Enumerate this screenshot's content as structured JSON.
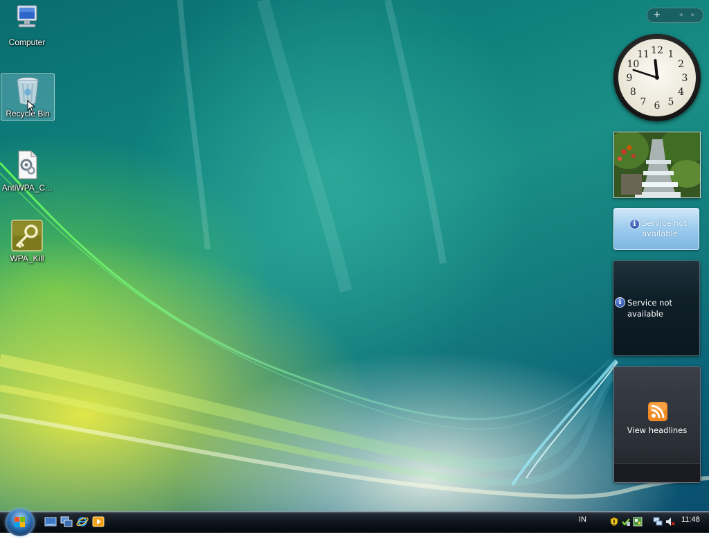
{
  "desktop": {
    "icons": [
      {
        "label": "Computer",
        "icon": "computer-icon"
      },
      {
        "label": "Recycle Bin",
        "icon": "recycle-bin-icon"
      },
      {
        "label": "AntiWPA_C...",
        "icon": "settings-file-icon"
      },
      {
        "label": "WPA_Kill",
        "icon": "key-icon"
      }
    ]
  },
  "sidebar": {
    "controls": {
      "add": "+",
      "prev": "◂",
      "next": "▸"
    },
    "clock": {
      "time": "11:48"
    },
    "weather": {
      "message": "Service not available"
    },
    "stocks": {
      "message": "Service not available"
    },
    "feed": {
      "label": "View headlines"
    }
  },
  "taskbar": {
    "language": "IN",
    "time": "11:48",
    "quick_launch": [
      "show-desktop-icon",
      "switch-windows-icon",
      "internet-explorer-icon",
      "media-player-icon"
    ],
    "tray": [
      "security-shield-icon",
      "defender-icon",
      "network-icon",
      "volume-muted-icon"
    ]
  },
  "colors": {
    "desktop_teal": "#0e7f7c",
    "desktop_yellow": "#e8e84a",
    "taskbar": "#0f151c",
    "weather_blue": "#9fcdef"
  }
}
